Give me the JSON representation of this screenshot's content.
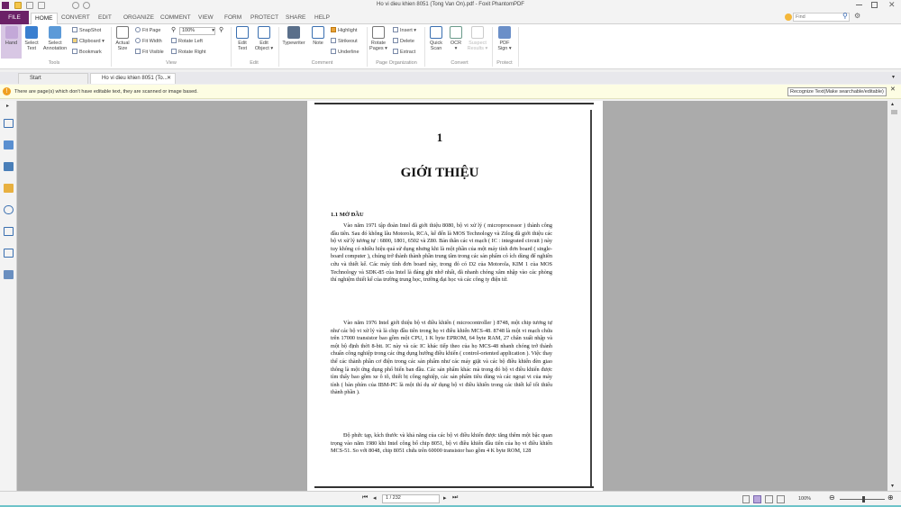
{
  "window": {
    "title": "Ho vi dieu khien 8051 (Tong Van On).pdf - Foxit PhantomPDF"
  },
  "menu": {
    "tabs": [
      "FILE",
      "HOME",
      "CONVERT",
      "EDIT",
      "ORGANIZE",
      "COMMENT",
      "VIEW",
      "FORM",
      "PROTECT",
      "SHARE",
      "HELP"
    ]
  },
  "search": {
    "placeholder": "Find"
  },
  "ribbon": {
    "tools": {
      "hand": "Hand",
      "select_text": "Select Text",
      "select_annotation": "Select Annotation",
      "snapshot": "SnapShot",
      "clipboard": "Clipboard",
      "bookmark": "Bookmark",
      "group": "Tools"
    },
    "view": {
      "actual_size": "Actual Size",
      "fit_page": "Fit Page",
      "fit_width": "Fit Width",
      "fit_visible": "Fit Visible",
      "zoom": "100%",
      "rotate_left": "Rotate Left",
      "rotate_right": "Rotate Right",
      "group": "View"
    },
    "edit": {
      "edit_text": "Edit Text",
      "edit_object": "Edit Object",
      "group": "Edit"
    },
    "comment": {
      "typewriter": "Typewriter",
      "note": "Note",
      "highlight": "Highlight",
      "strikeout": "Strikeout",
      "underline": "Underline",
      "group": "Comment"
    },
    "organize": {
      "rotate_pages": "Rotate Pages",
      "insert": "Insert",
      "delete": "Delete",
      "extract": "Extract",
      "group": "Page Organization"
    },
    "convert": {
      "quick_scan": "Quick Scan",
      "ocr": "OCR",
      "suspect": "Suspect Results",
      "group": "Convert"
    },
    "protect": {
      "pdf_sign": "PDF Sign",
      "group": "Protect"
    }
  },
  "doctabs": [
    {
      "label": "Start"
    },
    {
      "label": "Ho vi dieu khien 8051 (To..."
    }
  ],
  "warning": {
    "text": "There are page(s) which don't have editable text, they are scanned or image based.",
    "button": "Recognize Text(Make searchable/editable)"
  },
  "document": {
    "chapter": "1",
    "title": "GIỚI THIỆU",
    "section": "1.1  MỞ ĐẦU",
    "paragraphs": [
      "Vào năm 1971 tập đoàn Intel đã giới thiệu 8080, bộ vi xử lý ( microprocessor ) thành công đầu tiên. Sau đó không lâu Motorola, RCA, kế đến là MOS Technology và Zilog đã giới thiệu các bộ vi xử lý tương tự : 6800, 1801, 6502 và Z80. Bản thân các vi mạch ( IC : integrated circuit ) này tuy không có nhiều hiệu quả sử dụng nhưng khi là một phần của một máy tính đơn board ( single-board computer ), chúng trở thành thành phần trung tâm trong các sản phẩm có ích dùng để nghiên cứu và thiết kế. Các máy tính đơn board này, trong đó có D2 của Motorola, KIM 1 của MOS Technology và SDK-85 của Intel là đáng ghi nhớ nhất, đã nhanh chóng xâm nhập vào các phòng thí nghiệm thiết kế của trường trung học, trường đại học và các công ty điện tử.",
      "Vào năm 1976 Intel giới thiệu bộ vi điều khiển ( microcontroller ) 8748, một chip tương tự như các bộ vi xử lý và là chip đầu tiên trong họ vi điều khiển MCS-48. 8748 là một vi mạch chứa trên 17000 transistor bao gồm một CPU, 1 K byte EPROM, 64 byte RAM, 27 chân xuất nhập và một bộ định thời 8-bit. IC này và các IC khác tiếp theo của họ MCS-48 nhanh chóng trở thành chuẩn công nghiệp trong các ứng dụng hướng điều khiển ( control-oriented application ). Việc thay thế các thành phần cơ điện trong các sản phẩm như các máy giặt và các bộ điều khiển đèn giao thông là một ứng dụng phổ biến ban đầu. Các sản phẩm khác mà trong đó bộ vi điều khiển được tìm thấy bao gồm xe ô tô, thiết bị công nghiệp, các sản phẩm tiêu dùng và các ngoại vi của máy tính ( bàn phím của IBM-PC là một thí dụ sử dụng bộ vi điều khiển trong các thiết kế tối thiểu thành phần ).",
      "Độ phức tạp, kích thước và khả năng của các bộ vi điều khiển được tăng thêm một bậc quan trọng vào năm 1980 khi Intel công bố chip 8051, bộ vi điều khiển đầu tiên của họ vi điều khiển MCS-51. So với 8048, chip 8051 chứa trên 60000 transistor bao gồm 4 K byte ROM, 128"
    ]
  },
  "status": {
    "page": "1 / 232",
    "zoom": "100%",
    "zoom_level": 0.5
  }
}
